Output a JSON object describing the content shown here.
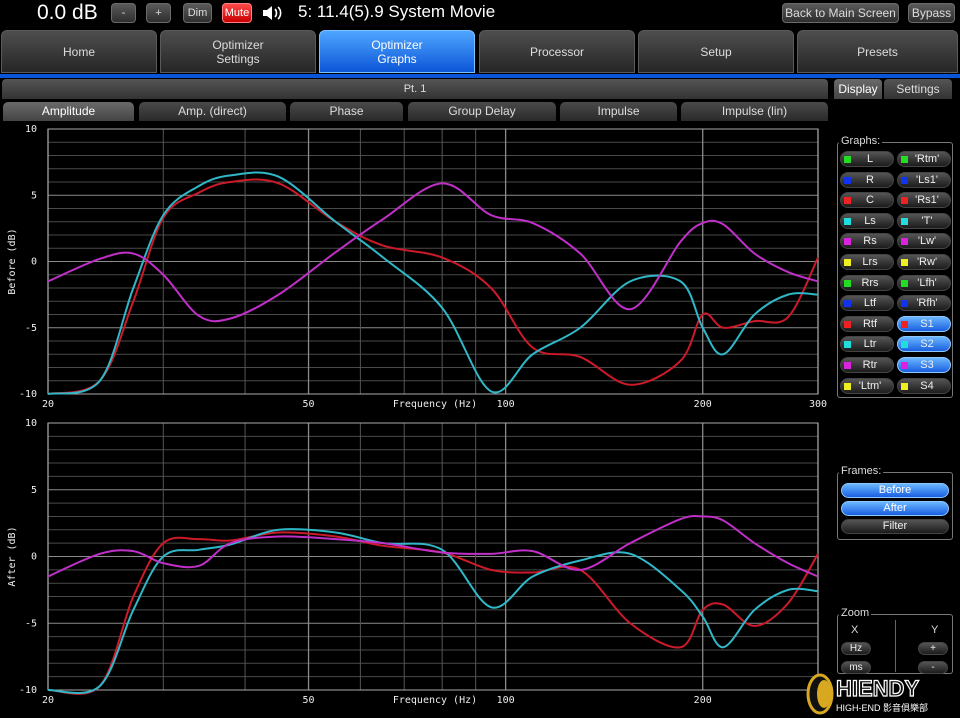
{
  "topbar": {
    "volume": "0.0 dB",
    "minus_label": "-",
    "plus_label": "+",
    "dim_label": "Dim",
    "mute_label": "Mute",
    "system_name": "5: 11.4(5).9 System Movie",
    "back_label": "Back to Main Screen",
    "bypass_label": "Bypass",
    "icon": "speaker-volume-icon"
  },
  "nav": {
    "tabs": [
      {
        "label": "Home"
      },
      {
        "label": "Optimizer\nSettings"
      },
      {
        "label": "Optimizer\nGraphs",
        "active": true
      },
      {
        "label": "Processor"
      },
      {
        "label": "Setup"
      },
      {
        "label": "Presets"
      }
    ]
  },
  "point_bar": "Pt. 1",
  "right_tabs": [
    {
      "label": "Display",
      "active": true
    },
    {
      "label": "Settings"
    }
  ],
  "graph_tabs": [
    {
      "label": "Amplitude",
      "active": true
    },
    {
      "label": "Amp. (direct)"
    },
    {
      "label": "Phase"
    },
    {
      "label": "Group Delay"
    },
    {
      "label": "Impulse"
    },
    {
      "label": "Impulse (lin)"
    }
  ],
  "graphs_panel": {
    "title": "Graphs:",
    "channels": [
      {
        "label": "L",
        "color": "#22dd22",
        "on": false
      },
      {
        "label": "'Rtm'",
        "color": "#22dd22",
        "on": false
      },
      {
        "label": "R",
        "color": "#1133ee",
        "on": false
      },
      {
        "label": "'Ls1'",
        "color": "#1133ee",
        "on": false
      },
      {
        "label": "C",
        "color": "#ee2222",
        "on": false
      },
      {
        "label": "'Rs1'",
        "color": "#ee2222",
        "on": false
      },
      {
        "label": "Ls",
        "color": "#22dddd",
        "on": false
      },
      {
        "label": "'T'",
        "color": "#22dddd",
        "on": false
      },
      {
        "label": "Rs",
        "color": "#dd22dd",
        "on": false
      },
      {
        "label": "'Lw'",
        "color": "#dd22dd",
        "on": false
      },
      {
        "label": "Lrs",
        "color": "#eeee22",
        "on": false
      },
      {
        "label": "'Rw'",
        "color": "#eeee22",
        "on": false
      },
      {
        "label": "Rrs",
        "color": "#22dd22",
        "on": false
      },
      {
        "label": "'Lfh'",
        "color": "#22dd22",
        "on": false
      },
      {
        "label": "Ltf",
        "color": "#1133ee",
        "on": false
      },
      {
        "label": "'Rfh'",
        "color": "#1133ee",
        "on": false
      },
      {
        "label": "Rtf",
        "color": "#ee2222",
        "on": false
      },
      {
        "label": "S1",
        "color": "#ee2222",
        "on": true
      },
      {
        "label": "Ltr",
        "color": "#22dddd",
        "on": false
      },
      {
        "label": "S2",
        "color": "#22dddd",
        "on": true
      },
      {
        "label": "Rtr",
        "color": "#dd22dd",
        "on": false
      },
      {
        "label": "S3",
        "color": "#dd22dd",
        "on": true
      },
      {
        "label": "'Ltm'",
        "color": "#eeee22",
        "on": false
      },
      {
        "label": "S4",
        "color": "#eeee22",
        "on": false
      }
    ]
  },
  "frames_panel": {
    "title": "Frames:",
    "buttons": [
      {
        "label": "Before",
        "on": true
      },
      {
        "label": "After",
        "on": true
      },
      {
        "label": "Filter",
        "on": false
      }
    ]
  },
  "zoom_panel": {
    "title": "Zoom",
    "x_label": "X",
    "y_label": "Y",
    "hz_label": "Hz",
    "ms_label": "ms",
    "plus_label": "+",
    "minus_label": "-"
  },
  "watermark": {
    "text_main": "HIENDY",
    "text_sub": "HIGH-END 影音俱樂部"
  },
  "chart_data": [
    {
      "type": "line",
      "title": "",
      "xlabel": "Frequency (Hz)",
      "ylabel": "Before (dB)",
      "xscale": "log",
      "xlim": [
        20,
        300
      ],
      "ylim": [
        -10,
        10
      ],
      "xticks": [
        20,
        50,
        100,
        200,
        300
      ],
      "yticks": [
        10,
        5,
        0,
        -5,
        -10
      ],
      "grid": true,
      "series": [
        {
          "color": "#cc1a2a",
          "x": [
            20,
            24,
            27,
            30,
            34,
            38,
            45,
            55,
            65,
            80,
            95,
            110,
            130,
            155,
            185,
            200,
            215,
            240,
            270,
            300
          ],
          "y": [
            -10,
            -9,
            -3,
            3.3,
            5.2,
            6,
            5.9,
            3,
            1.2,
            0.3,
            -2,
            -6.5,
            -7.2,
            -9.3,
            -7.5,
            -4,
            -5,
            -4.5,
            -4.2,
            0.3
          ]
        },
        {
          "color": "#30b8c8",
          "x": [
            20,
            24,
            27,
            30,
            34,
            38,
            45,
            55,
            65,
            80,
            95,
            110,
            130,
            155,
            185,
            200,
            215,
            240,
            270,
            300
          ],
          "y": [
            -10,
            -9,
            -2,
            3.5,
            5.7,
            6.5,
            6.4,
            3,
            0.3,
            -3.5,
            -9.8,
            -7,
            -5,
            -1.5,
            -1.5,
            -5,
            -7,
            -4,
            -2.5,
            -2.5
          ]
        },
        {
          "color": "#c030c8",
          "x": [
            20,
            24,
            27,
            30,
            34,
            38,
            45,
            55,
            65,
            80,
            95,
            110,
            130,
            155,
            185,
            200,
            215,
            240,
            270,
            300
          ],
          "y": [
            -1.5,
            0.2,
            0.6,
            -1,
            -4.1,
            -4.3,
            -2.5,
            0.7,
            3.2,
            5.9,
            3.5,
            2.9,
            0.6,
            -3.6,
            1.5,
            2.9,
            2.8,
            0.6,
            -0.8,
            -1.5
          ]
        }
      ]
    },
    {
      "type": "line",
      "title": "",
      "xlabel": "Frequency (Hz)",
      "ylabel": "After (dB)",
      "xscale": "log",
      "xlim": [
        20,
        300
      ],
      "ylim": [
        -10,
        10
      ],
      "xticks": [
        20,
        50,
        100,
        200,
        300
      ],
      "yticks": [
        10,
        5,
        0,
        -5,
        -10
      ],
      "grid": true,
      "series": [
        {
          "color": "#cc1a2a",
          "x": [
            20,
            24,
            27,
            30,
            34,
            38,
            45,
            55,
            65,
            80,
            95,
            110,
            130,
            155,
            185,
            200,
            215,
            240,
            270,
            300
          ],
          "y": [
            -10,
            -9.7,
            -3,
            1,
            1.3,
            1.2,
            1.8,
            1.5,
            0.8,
            0.3,
            -1,
            -1.2,
            -1,
            -5,
            -6.8,
            -4,
            -3.6,
            -5.2,
            -3.5,
            0.2
          ]
        },
        {
          "color": "#30b8c8",
          "x": [
            20,
            24,
            27,
            30,
            34,
            38,
            45,
            55,
            65,
            80,
            95,
            110,
            130,
            155,
            185,
            200,
            215,
            240,
            270,
            300
          ],
          "y": [
            -10,
            -9.7,
            -4,
            0,
            0.5,
            0.9,
            2,
            1.8,
            1,
            0.5,
            -3.8,
            -1.5,
            -0.3,
            0.2,
            -2.5,
            -4.5,
            -6.8,
            -4,
            -2.5,
            -2.6
          ]
        },
        {
          "color": "#c030c8",
          "x": [
            20,
            24,
            27,
            30,
            34,
            38,
            45,
            55,
            65,
            80,
            95,
            110,
            130,
            155,
            185,
            200,
            215,
            240,
            270,
            300
          ],
          "y": [
            -1.5,
            0.2,
            0.4,
            -0.5,
            -0.7,
            1,
            1.5,
            1.3,
            1,
            0.3,
            0.2,
            0.4,
            -1,
            1,
            2.8,
            3,
            2.7,
            1,
            -0.5,
            -1.5
          ]
        }
      ]
    }
  ]
}
